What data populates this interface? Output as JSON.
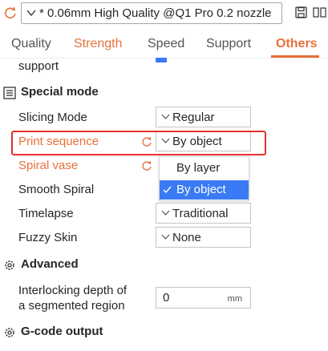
{
  "preset": {
    "name": "* 0.06mm High Quality @Q1 Pro 0.2 nozzle",
    "reset_icon": "reset-arrow-icon",
    "save_icon": "save-icon",
    "compare_icon": "compare-icon"
  },
  "tabs": [
    {
      "label": "Quality",
      "state": "normal"
    },
    {
      "label": "Strength",
      "state": "modified"
    },
    {
      "label": "Speed",
      "state": "normal"
    },
    {
      "label": "Support",
      "state": "normal"
    },
    {
      "label": "Others",
      "state": "active"
    }
  ],
  "partial_row": {
    "label": "support"
  },
  "sections": {
    "special_mode": "Special mode",
    "advanced": "Advanced",
    "gcode_output": "G-code output"
  },
  "special_mode": {
    "slicing_mode": {
      "label": "Slicing Mode",
      "value": "Regular"
    },
    "print_sequence": {
      "label": "Print sequence",
      "value": "By object"
    },
    "spiral_vase": {
      "label": "Spiral vase"
    },
    "smooth_spiral": {
      "label": "Smooth Spiral"
    },
    "timelapse": {
      "label": "Timelapse",
      "value": "Traditional"
    },
    "fuzzy_skin": {
      "label": "Fuzzy Skin",
      "value": "None"
    }
  },
  "print_sequence_options": [
    {
      "label": "By layer",
      "selected": false
    },
    {
      "label": "By object",
      "selected": true
    }
  ],
  "advanced": {
    "interlocking_label_1": "Interlocking depth of",
    "interlocking_label_2": "a segmented region",
    "interlocking_value": "0",
    "interlocking_unit": "mm"
  },
  "colors": {
    "accent": "#e8703a",
    "selection": "#3a7bf5",
    "highlight": "#e5322e"
  }
}
